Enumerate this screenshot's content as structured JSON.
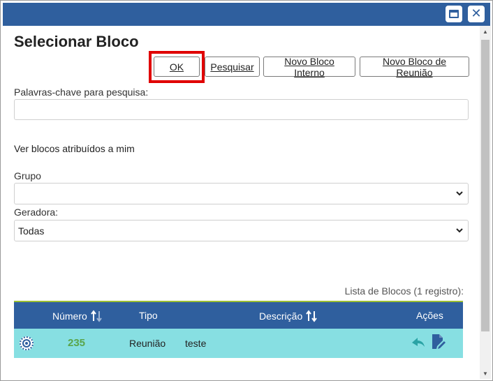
{
  "window": {
    "controls": [
      "maximize-icon",
      "close-icon"
    ],
    "accent": "#2f5f9e"
  },
  "page": {
    "title": "Selecionar Bloco"
  },
  "toolbar": {
    "ok_label": "OK",
    "search_label": "Pesquisar",
    "new_internal_label": "Novo Bloco Interno",
    "new_meeting_label": "Novo Bloco de Reunião",
    "highlight_color": "#e00000"
  },
  "form": {
    "keywords_label": "Palavras-chave para pesquisa:",
    "keywords_value": "",
    "assigned_link": "Ver blocos atribuídos a mim",
    "group_label": "Grupo",
    "group_value": "",
    "generator_label": "Geradora:",
    "generator_value": "Todas"
  },
  "list": {
    "caption": "Lista de Blocos (1 registro):",
    "columns": {
      "numero": "Número",
      "tipo": "Tipo",
      "descricao": "Descrição",
      "acoes": "Ações"
    },
    "rows": [
      {
        "numero": "235",
        "tipo": "Reunião",
        "descricao": "teste",
        "selected": true
      }
    ],
    "row_color": "#87dfe2",
    "number_color": "#5aa54a"
  }
}
